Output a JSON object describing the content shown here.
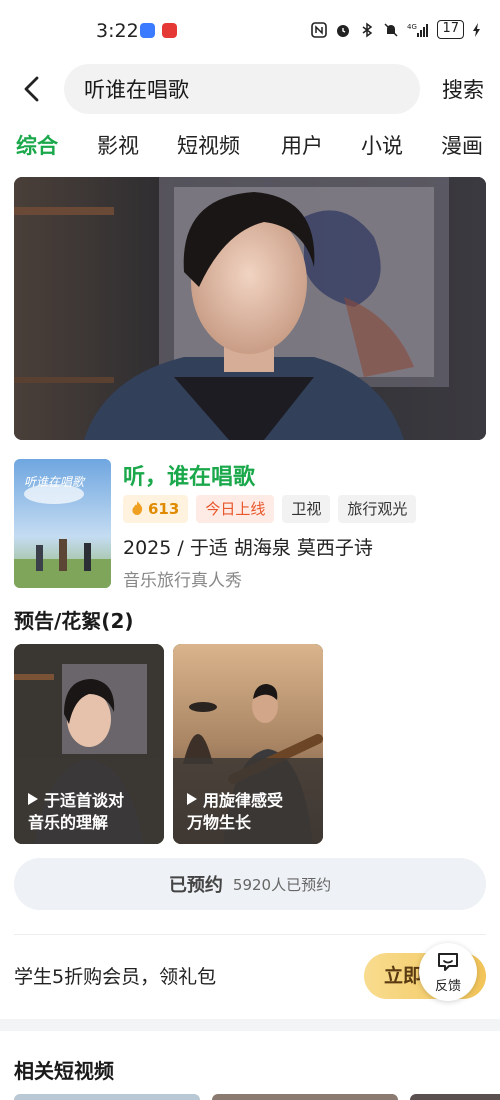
{
  "status_bar": {
    "time": "3:22",
    "battery": "17"
  },
  "search": {
    "query": "听谁在唱歌",
    "button": "搜索"
  },
  "tabs": [
    "综合",
    "影视",
    "短视频",
    "用户",
    "小说",
    "漫画"
  ],
  "show": {
    "title": "听，谁在唱歌",
    "poster_text": "听谁在唱歌",
    "heat": "613",
    "tags": [
      "今日上线",
      "卫视",
      "旅行观光"
    ],
    "meta": "2025 / 于适  胡海泉  莫西子诗",
    "genre": "音乐旅行真人秀"
  },
  "clips": {
    "title": "预告/花絮(2)",
    "items": [
      {
        "caption_line1": "于适首谈对",
        "caption_line2": "音乐的理解"
      },
      {
        "caption_line1": "用旋律感受",
        "caption_line2": "万物生长"
      }
    ]
  },
  "reserve": {
    "label": "已预约",
    "count": "5920人已预约"
  },
  "promo": {
    "text": "学生5折购会员，领礼包",
    "button": "立即"
  },
  "feedback": {
    "label": "反馈"
  },
  "related": {
    "title": "相关短视频"
  },
  "colors": {
    "accent_green": "#1aa84b",
    "promo_gold": "#f2c458"
  },
  "icons": [
    "chevron-left-icon",
    "flame-icon",
    "play-icon",
    "feedback-icon",
    "wifi-icon",
    "bluetooth-icon",
    "battery-icon"
  ]
}
